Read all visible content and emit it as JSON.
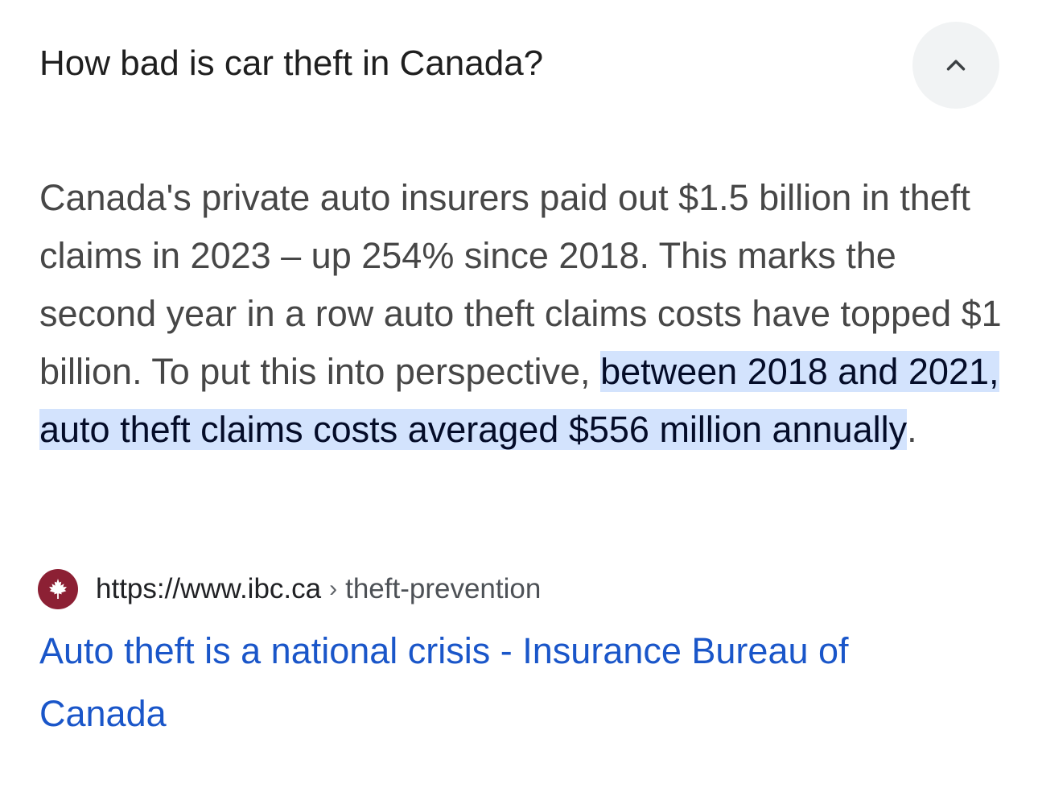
{
  "question": {
    "title": "How bad is car theft in Canada?",
    "toggle_icon": "chevron-up-icon"
  },
  "answer": {
    "text_before": "Canada's private auto insurers paid out $1.5 billion in theft claims in 2023 – up 254% since 2018. This marks the second year in a row auto theft claims costs have topped $1 billion. To put this into perspective, ",
    "highlighted": "between 2018 and 2021, auto theft claims costs averaged $556 million annually",
    "text_after": "."
  },
  "source": {
    "favicon_icon": "ibc-maple-leaf-icon",
    "domain": "https://www.ibc.ca",
    "separator": "›",
    "path": "theft-prevention"
  },
  "result": {
    "title": "Auto theft is a national crisis - Insurance Bureau of Canada"
  },
  "colors": {
    "highlight_bg": "#d3e3fd",
    "link": "#1a56c9",
    "favicon_bg": "#8c2034",
    "toggle_bg": "#f1f3f4"
  }
}
